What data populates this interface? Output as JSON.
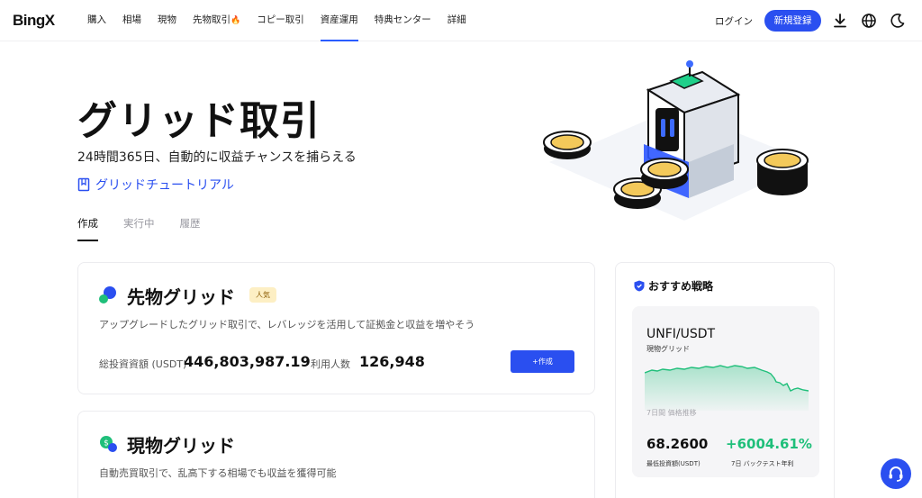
{
  "brand": {
    "logo": "BingX",
    "accent": "#2a4ff0"
  },
  "nav": {
    "items": [
      "購入",
      "相場",
      "現物",
      "先物取引",
      "コピー取引",
      "資産運用",
      "特典センター",
      "詳細"
    ],
    "active_index": 5,
    "login": "ログイン",
    "signup": "新規登録",
    "icons": [
      "download-icon",
      "globe-icon",
      "moon-icon"
    ]
  },
  "hero": {
    "title": "グリッド取引",
    "subtitle": "24時間365日、自動的に収益チャンスを捕らえる",
    "tutorial_link": "グリッドチュートリアル"
  },
  "tabs": [
    {
      "label": "作成",
      "active": true
    },
    {
      "label": "実行中",
      "active": false
    },
    {
      "label": "履歴",
      "active": false
    }
  ],
  "cards": [
    {
      "title": "先物グリッド",
      "badge": "人気",
      "description": "アップグレードしたグリッド取引で、レバレッジを活用して証拠金と収益を増やそう",
      "total_label": "総投資資額 (USDT)",
      "total_value": "446,803,987.19",
      "users_label": "利用人数",
      "users_value": "126,948",
      "button": "+作成"
    },
    {
      "title": "現物グリッド",
      "description": "自動売買取引で、乱高下する相場でも収益を獲得可能"
    }
  ],
  "recommend": {
    "heading": "おすすめ戦略",
    "pair": "UNFI/USDT",
    "type": "現物グリッド",
    "trend_label": "7日間 価格推移",
    "min_investment": "68.2600",
    "min_investment_label": "最低投資額(USDT)",
    "apr": "+6004.61%",
    "apr_label": "7日 バックテスト年利",
    "spark_color": "#1fbf7a"
  }
}
